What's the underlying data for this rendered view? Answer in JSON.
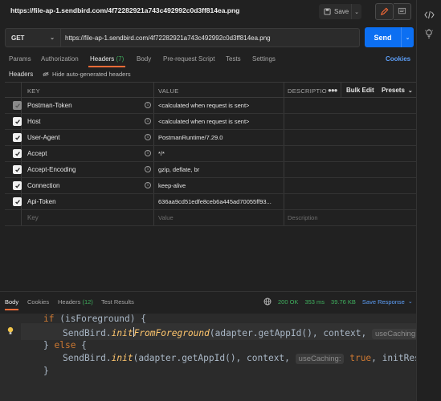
{
  "window": {
    "title_url": "https://file-ap-1.sendbird.com/4f72282921a743c492992c0d3ff814ea.png",
    "save_label": "Save"
  },
  "icons": {
    "save": "save-icon",
    "edit": "pencil-icon",
    "comment": "comment-icon",
    "code": "code-icon",
    "bulb": "lightbulb-icon"
  },
  "request": {
    "method": "GET",
    "url": "https://file-ap-1.sendbird.com/4f72282921a743c492992c0d3ff814ea.png",
    "send_label": "Send"
  },
  "tabs": [
    {
      "label": "Params"
    },
    {
      "label": "Authorization"
    },
    {
      "label": "Headers",
      "count": "(7)"
    },
    {
      "label": "Body"
    },
    {
      "label": "Pre-request Script"
    },
    {
      "label": "Tests"
    },
    {
      "label": "Settings"
    }
  ],
  "cookies_label": "Cookies",
  "headers_section": {
    "label": "Headers",
    "hide_auto": "Hide auto-generated headers"
  },
  "table": {
    "columns": [
      "KEY",
      "VALUE",
      "DESCRIPTIO"
    ],
    "bulk_edit": "Bulk Edit",
    "presets": "Presets",
    "rows": [
      {
        "key": "Postman-Token",
        "value": "<calculated when request is sent>",
        "disabled": true
      },
      {
        "key": "Host",
        "value": "<calculated when request is sent>",
        "disabled": false
      },
      {
        "key": "User-Agent",
        "value": "PostmanRuntime/7.29.0",
        "disabled": false
      },
      {
        "key": "Accept",
        "value": "*/*",
        "disabled": false
      },
      {
        "key": "Accept-Encoding",
        "value": "gzip, deflate, br",
        "disabled": false
      },
      {
        "key": "Connection",
        "value": "keep-alive",
        "disabled": false
      },
      {
        "key": "Api-Token",
        "value": "636aa9cd51edfe8ceb6a445ad70055ff93...",
        "disabled": false
      }
    ],
    "placeholder": {
      "key": "Key",
      "value": "Value",
      "description": "Description"
    }
  },
  "response": {
    "tabs": [
      {
        "label": "Body"
      },
      {
        "label": "Cookies"
      },
      {
        "label": "Headers",
        "count": "(12)"
      },
      {
        "label": "Test Results"
      }
    ],
    "status": "200 OK",
    "time": "353 ms",
    "size": "39.76 KB",
    "save_response": "Save Response"
  },
  "code": {
    "lines": [
      "if (isForeground) {",
      "SendBird.initFromForeground(adapter.getAppId(), context, useCaching: true",
      "} else {",
      "SendBird.init(adapter.getAppId(), context, useCaching: true, initResultH",
      "}"
    ],
    "tokens": {
      "if": "if",
      "cond": " (isForeground) {",
      "obj": "SendBird.",
      "init_from_fg_a": "init",
      "init_from_fg_b": "FromForeground",
      "args1": "(adapter.getAppId(), context, ",
      "hint": "useCaching:",
      "true": "true",
      "else_open": "} ",
      "else": "else",
      "else_close": " {",
      "init": "init",
      "args2": "(adapter.getAppId(), context, ",
      "tail2": ", initResultH",
      "close": "}"
    }
  },
  "colors": {
    "accent_orange": "#ff6c37",
    "send_blue": "#0c6ff2",
    "link_blue": "#5c9df5",
    "status_green": "#3fae5d",
    "keyword": "#cc7832",
    "function": "#ffc66d"
  }
}
